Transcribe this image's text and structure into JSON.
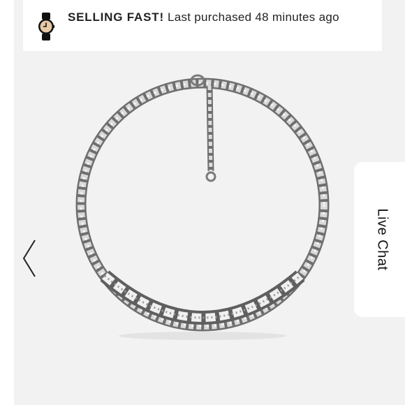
{
  "banner": {
    "icon": "watch-icon",
    "headline": "SELLING FAST!",
    "message": "Last purchased 48 minutes ago"
  },
  "product": {
    "image": "silver-chain-necklace"
  },
  "carousel": {
    "prev_icon": "chevron-left-icon"
  },
  "live_chat": {
    "label": "Live Chat"
  },
  "colors": {
    "background": "#f2f2f2",
    "banner_bg": "#ffffff",
    "watch_face": "#e8c9a6",
    "text": "#222222"
  }
}
